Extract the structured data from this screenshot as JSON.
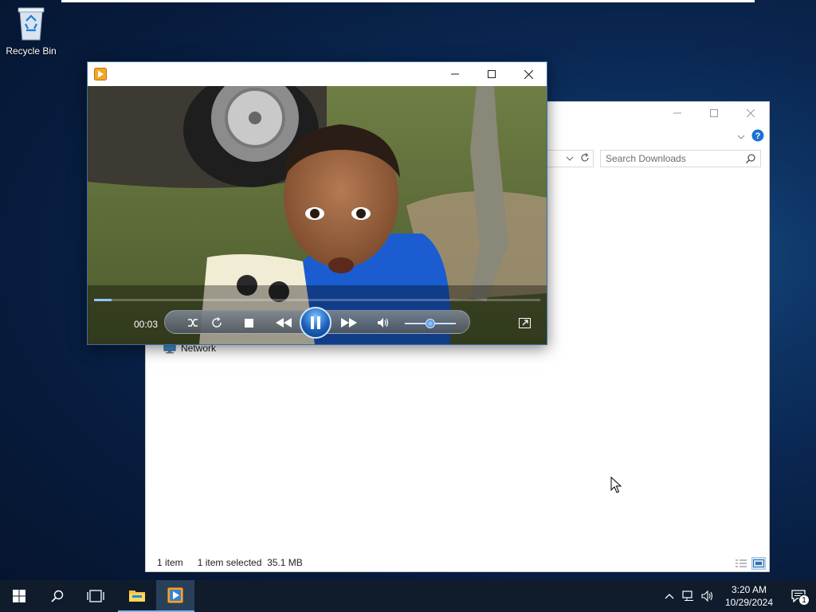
{
  "desktop": {
    "icons": [
      {
        "label": "Recycle Bin",
        "icon": "recycle-bin-icon"
      }
    ]
  },
  "explorer": {
    "search_placeholder": "Search Downloads",
    "nav_item": "Network",
    "status": {
      "items": "1 item",
      "selected": "1 item selected",
      "size": "35.1 MB"
    }
  },
  "player": {
    "time": "00:03",
    "progress": 0.04,
    "volume": 0.5,
    "state": "playing"
  },
  "taskbar": {
    "buttons": [
      "start-icon",
      "search-icon",
      "task-view-icon",
      "file-explorer-icon",
      "media-player-icon"
    ],
    "clock_time": "3:20 AM",
    "clock_date": "10/29/2024",
    "notification_count": "1"
  },
  "colors": {
    "accent": "#7ab4ea",
    "taskbar": "#101c2c"
  }
}
